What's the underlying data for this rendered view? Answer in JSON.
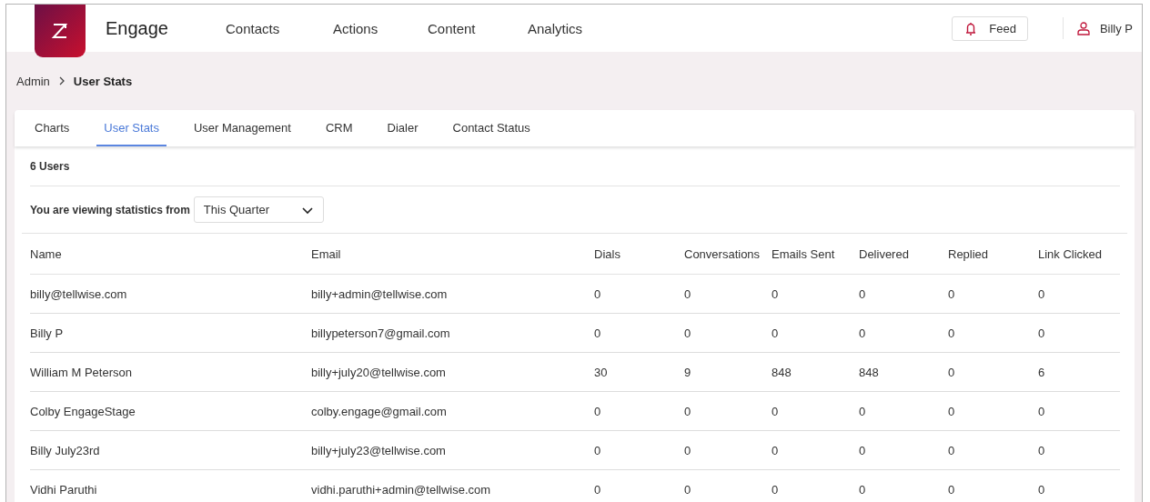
{
  "header": {
    "app_name": "Engage",
    "nav": [
      {
        "label": "Contacts"
      },
      {
        "label": "Actions"
      },
      {
        "label": "Content"
      },
      {
        "label": "Analytics"
      }
    ],
    "feed_button": "Feed",
    "user_name": "Billy P"
  },
  "breadcrumb": [
    "Admin",
    "User Stats"
  ],
  "tabs": [
    {
      "label": "Charts",
      "selected": false
    },
    {
      "label": "User Stats",
      "selected": true
    },
    {
      "label": "User Management",
      "selected": false
    },
    {
      "label": "CRM",
      "selected": false
    },
    {
      "label": "Dialer",
      "selected": false
    },
    {
      "label": "Contact Status",
      "selected": false
    }
  ],
  "user_count": "6 Users",
  "period": {
    "label": "You are viewing statistics from",
    "value": "This Quarter"
  },
  "table": {
    "columns": [
      "Name",
      "Email",
      "Dials",
      "Conversations",
      "Emails Sent",
      "Delivered",
      "Replied",
      "Link Clicked"
    ],
    "rows": [
      [
        "billy@tellwise.com",
        "billy+admin@tellwise.com",
        "0",
        "0",
        "0",
        "0",
        "0",
        "0"
      ],
      [
        "Billy P",
        "billypeterson7@gmail.com",
        "0",
        "0",
        "0",
        "0",
        "0",
        "0"
      ],
      [
        "William M Peterson",
        "billy+july20@tellwise.com",
        "30",
        "9",
        "848",
        "848",
        "0",
        "6"
      ],
      [
        "Colby EngageStage",
        "colby.engage@gmail.com",
        "0",
        "0",
        "0",
        "0",
        "0",
        "0"
      ],
      [
        "Billy July23rd",
        "billy+july23@tellwise.com",
        "0",
        "0",
        "0",
        "0",
        "0",
        "0"
      ],
      [
        "Vidhi Paruthi",
        "vidhi.paruthi+admin@tellwise.com",
        "0",
        "0",
        "0",
        "0",
        "0",
        "0"
      ]
    ]
  }
}
